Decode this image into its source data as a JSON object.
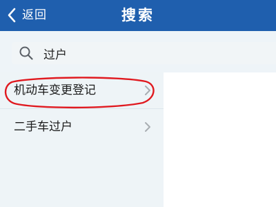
{
  "header": {
    "back_label": "返回",
    "title": "搜索",
    "background": "#1f5fae",
    "back_icon": "chevron-left-icon"
  },
  "search": {
    "value": "过户",
    "icon": "search-icon"
  },
  "results": {
    "items": [
      {
        "label": "机动车变更登记",
        "icon": "chevron-right-icon"
      },
      {
        "label": "二手车过户",
        "icon": "chevron-right-icon"
      }
    ]
  },
  "annotation": {
    "shape": "ellipse",
    "color": "#e0191f",
    "target": "机动车变更登记"
  }
}
